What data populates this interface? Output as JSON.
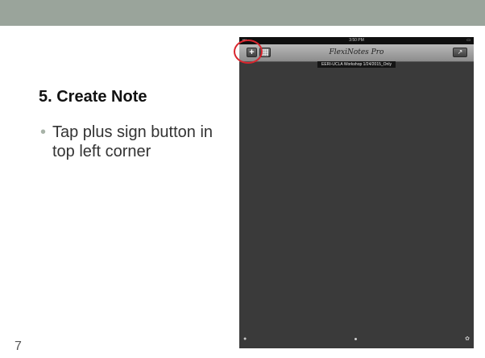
{
  "slide": {
    "title": "5. Create Note",
    "bullet": "Tap plus sign button in top left corner",
    "bullet_symbol": "•",
    "slide_number": "7",
    "header_color": "#9aa49b"
  },
  "ipad": {
    "status_time": "3:50 PM",
    "app_title": "FlexiNotes Pro",
    "notebook_label": "EERI-UCLA Workshop 1/24/2015_Only",
    "toolbar": {
      "add_button_glyph": "+",
      "library_button_glyph": "▦",
      "share_button_glyph": "↗"
    },
    "highlight_color": "#d9262e"
  }
}
